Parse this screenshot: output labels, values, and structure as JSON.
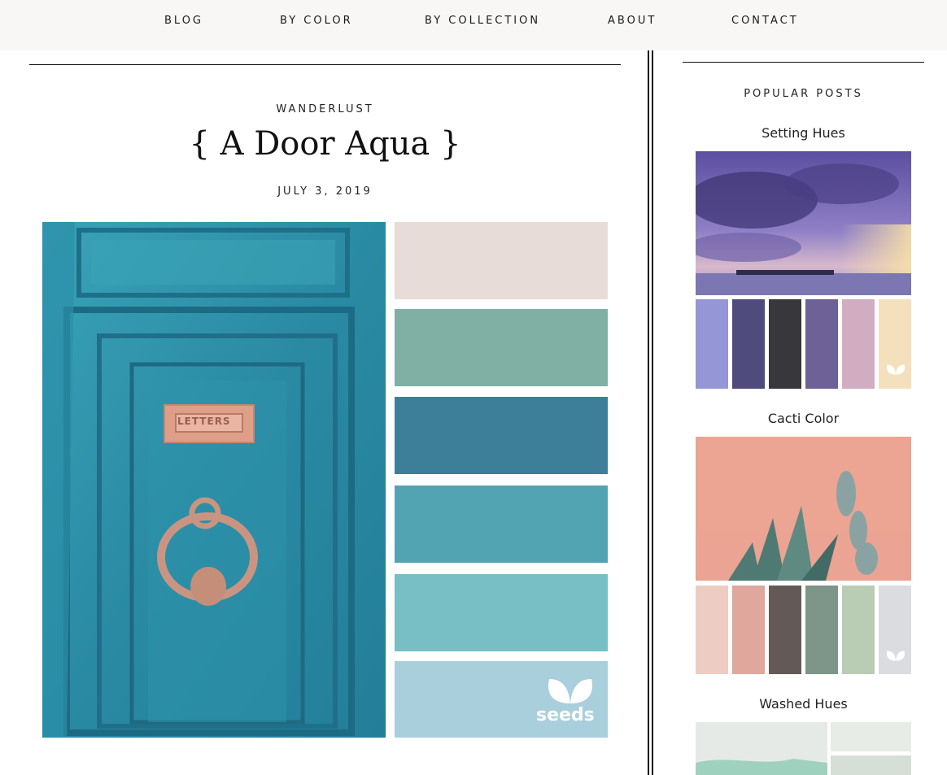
{
  "nav": {
    "items": [
      "BLOG",
      "BY COLOR",
      "BY COLLECTION",
      "ABOUT",
      "CONTACT"
    ]
  },
  "post": {
    "category": "WANDERLUST",
    "title": "{ A Door Aqua }",
    "date": "JULY 3, 2019",
    "image": {
      "sign_text": "LETTERS",
      "watermark": "seeds",
      "palette": [
        "#e8dcd8",
        "#80b0a3",
        "#3d7f98",
        "#53a4b3",
        "#77bfc5",
        "#a9cfdc"
      ]
    }
  },
  "sidebar": {
    "heading": "POPULAR POSTS",
    "posts": [
      {
        "title": "Setting Hues",
        "palette": [
          "#9596d5",
          "#4f4b7d",
          "#38373b",
          "#6e6197",
          "#d2adc2",
          "#f4e0bd"
        ]
      },
      {
        "title": "Cacti Color",
        "palette": [
          "#edcdc3",
          "#e0a79c",
          "#635956",
          "#7e958a",
          "#b9cdb4",
          "#dadcdf"
        ]
      },
      {
        "title": "Washed Hues",
        "palette": [
          "#e8ece6",
          "#d5dfd6"
        ]
      }
    ]
  }
}
